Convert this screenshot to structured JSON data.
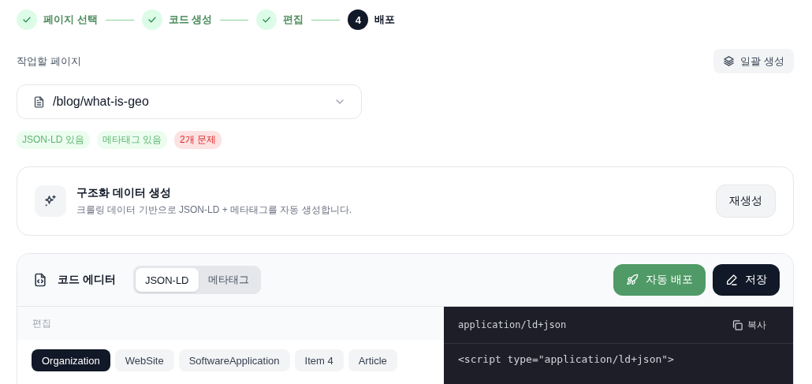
{
  "steps": [
    {
      "label": "페이지 선택",
      "done": true,
      "current": false
    },
    {
      "label": "코드 생성",
      "done": true,
      "current": false
    },
    {
      "label": "편집",
      "done": true,
      "current": false
    },
    {
      "label": "배포",
      "number": "4",
      "done": false,
      "current": true
    }
  ],
  "page_picker": {
    "label": "작업할 페이지",
    "value": "/blog/what-is-geo",
    "bulk_button": "일괄 생성"
  },
  "badges": [
    {
      "text": "JSON-LD 있음",
      "kind": "ok"
    },
    {
      "text": "메타태그 있음",
      "kind": "ok"
    },
    {
      "text": "2개 문제",
      "kind": "error"
    }
  ],
  "generate_card": {
    "title": "구조화 데이터 생성",
    "description": "크롤링 데이터 기반으로 JSON-LD + 메타태그를 자동 생성합니다.",
    "button": "재생성"
  },
  "editor": {
    "title": "코드 에디터",
    "tabs": [
      {
        "label": "JSON-LD",
        "selected": true
      },
      {
        "label": "메타태그",
        "selected": false
      }
    ],
    "deploy_button": "자동 배포",
    "save_button": "저장",
    "edit_label": "편집",
    "schemas": [
      {
        "label": "Organization",
        "selected": true
      },
      {
        "label": "WebSite",
        "selected": false
      },
      {
        "label": "SoftwareApplication",
        "selected": false
      },
      {
        "label": "Item 4",
        "selected": false
      },
      {
        "label": "Article",
        "selected": false
      }
    ],
    "code_type": "application/ld+json",
    "copy_button": "복사",
    "code_lines": [
      "<script type=\"application/ld+json\">"
    ]
  }
}
